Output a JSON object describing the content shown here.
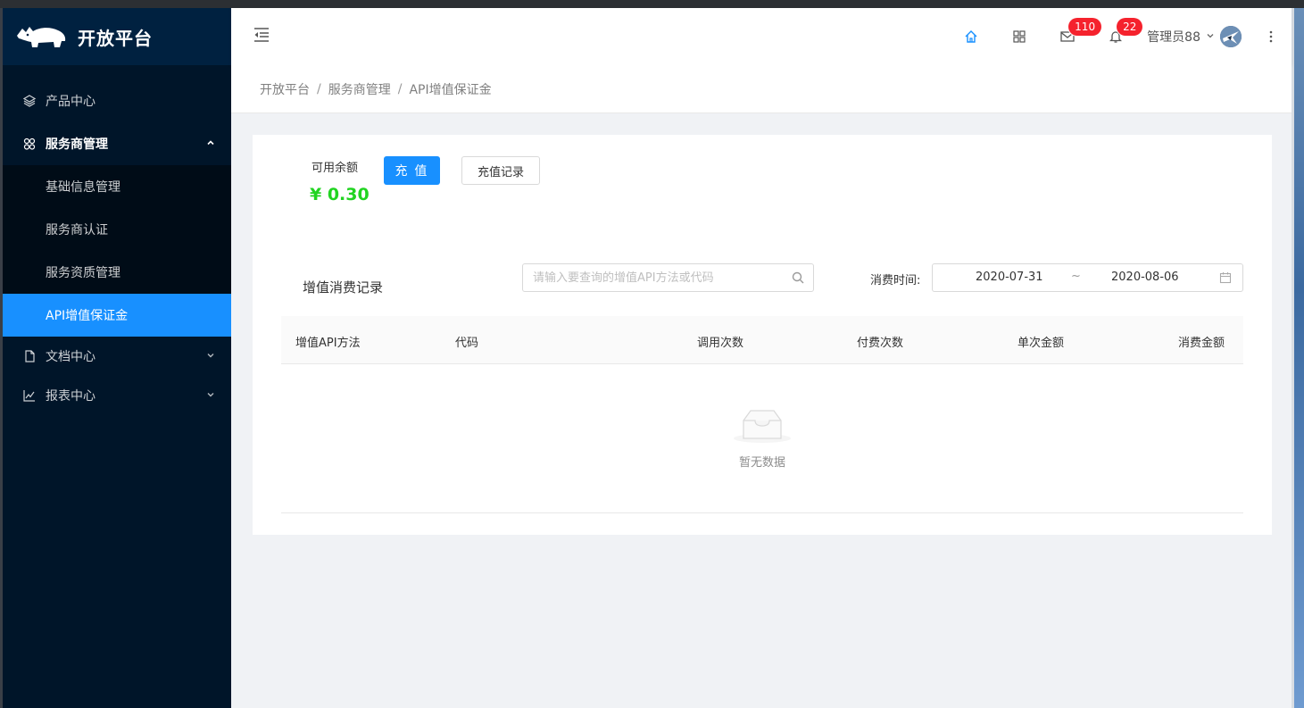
{
  "app": {
    "title": "开放平台"
  },
  "sidebar": {
    "items": [
      {
        "label": "产品中心",
        "icon": "layers-icon"
      },
      {
        "label": "服务商管理",
        "icon": "team-icon",
        "open": true,
        "children": [
          {
            "label": "基础信息管理"
          },
          {
            "label": "服务商认证"
          },
          {
            "label": "服务资质管理"
          },
          {
            "label": "API增值保证金",
            "active": true
          }
        ]
      },
      {
        "label": "文档中心",
        "icon": "file-icon"
      },
      {
        "label": "报表中心",
        "icon": "line-chart-icon"
      }
    ]
  },
  "header": {
    "mail_badge": "110",
    "bell_badge": "22",
    "user_name": "管理员88"
  },
  "breadcrumb": [
    "开放平台",
    "服务商管理",
    "API增值保证金"
  ],
  "balance": {
    "label": "可用余额",
    "value": "¥ 0.30",
    "recharge_label": "充 值",
    "records_label": "充值记录"
  },
  "records": {
    "title": "增值消费记录",
    "search_placeholder": "请输入要查询的增值API方法或代码",
    "date_label": "消费时间:",
    "date_start": "2020-07-31",
    "date_sep": "~",
    "date_end": "2020-08-06",
    "columns": [
      "增值API方法",
      "代码",
      "调用次数",
      "付费次数",
      "单次金额",
      "消费金额"
    ],
    "empty_text": "暂无数据"
  },
  "colors": {
    "primary": "#1890ff",
    "sidebar_bg": "#001529",
    "balance": "#21d421",
    "badge": "#f5222d"
  }
}
